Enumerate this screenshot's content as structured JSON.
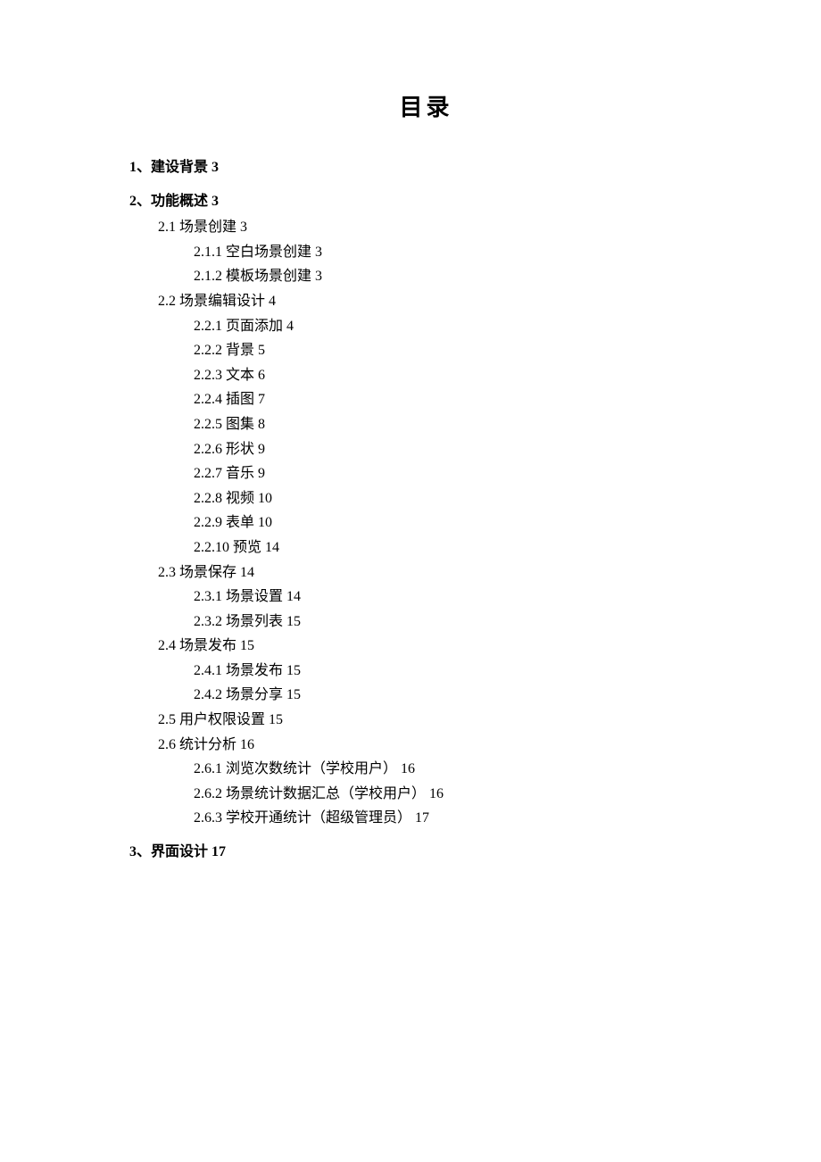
{
  "heading": "目录",
  "entries": [
    {
      "level": 1,
      "num": "1、",
      "title": "建设背景",
      "page": "3"
    },
    {
      "level": 1,
      "num": "2、",
      "title": "功能概述",
      "page": "3"
    },
    {
      "level": 2,
      "num": "2.1",
      "title": "场景创建",
      "page": "3"
    },
    {
      "level": 3,
      "num": "2.1.1",
      "title": "空白场景创建",
      "page": "3"
    },
    {
      "level": 3,
      "num": "2.1.2",
      "title": "模板场景创建",
      "page": "3"
    },
    {
      "level": 2,
      "num": "2.2",
      "title": "场景编辑设计",
      "page": "4"
    },
    {
      "level": 3,
      "num": "2.2.1",
      "title": "页面添加",
      "page": "4"
    },
    {
      "level": 3,
      "num": "2.2.2",
      "title": "背景",
      "page": "5"
    },
    {
      "level": 3,
      "num": "2.2.3",
      "title": "文本",
      "page": "6"
    },
    {
      "level": 3,
      "num": "2.2.4",
      "title": "插图",
      "page": "7"
    },
    {
      "level": 3,
      "num": "2.2.5",
      "title": "图集",
      "page": "8"
    },
    {
      "level": 3,
      "num": "2.2.6",
      "title": "形状",
      "page": "9"
    },
    {
      "level": 3,
      "num": "2.2.7",
      "title": "音乐",
      "page": "9"
    },
    {
      "level": 3,
      "num": "2.2.8",
      "title": "视频",
      "page": "10"
    },
    {
      "level": 3,
      "num": "2.2.9",
      "title": "表单",
      "page": "10"
    },
    {
      "level": 3,
      "num": "2.2.10",
      "title": "预览",
      "page": "14"
    },
    {
      "level": 2,
      "num": "2.3",
      "title": "场景保存",
      "page": "14"
    },
    {
      "level": 3,
      "num": "2.3.1",
      "title": "场景设置",
      "page": "14"
    },
    {
      "level": 3,
      "num": "2.3.2",
      "title": "场景列表",
      "page": "15"
    },
    {
      "level": 2,
      "num": "2.4",
      "title": "场景发布",
      "page": "15"
    },
    {
      "level": 3,
      "num": "2.4.1",
      "title": "场景发布",
      "page": "15"
    },
    {
      "level": 3,
      "num": "2.4.2",
      "title": "场景分享",
      "page": "15"
    },
    {
      "level": 2,
      "num": "2.5",
      "title": "用户权限设置",
      "page": "15"
    },
    {
      "level": 2,
      "num": "2.6",
      "title": "统计分析",
      "page": "16"
    },
    {
      "level": 3,
      "num": "2.6.1",
      "title": "浏览次数统计（学校用户）",
      "page": "16"
    },
    {
      "level": 3,
      "num": "2.6.2",
      "title": "场景统计数据汇总（学校用户）",
      "page": "16"
    },
    {
      "level": 3,
      "num": "2.6.3",
      "title": "学校开通统计（超级管理员）",
      "page": "17"
    },
    {
      "level": 1,
      "num": "3、",
      "title": "界面设计",
      "page": "17"
    }
  ]
}
